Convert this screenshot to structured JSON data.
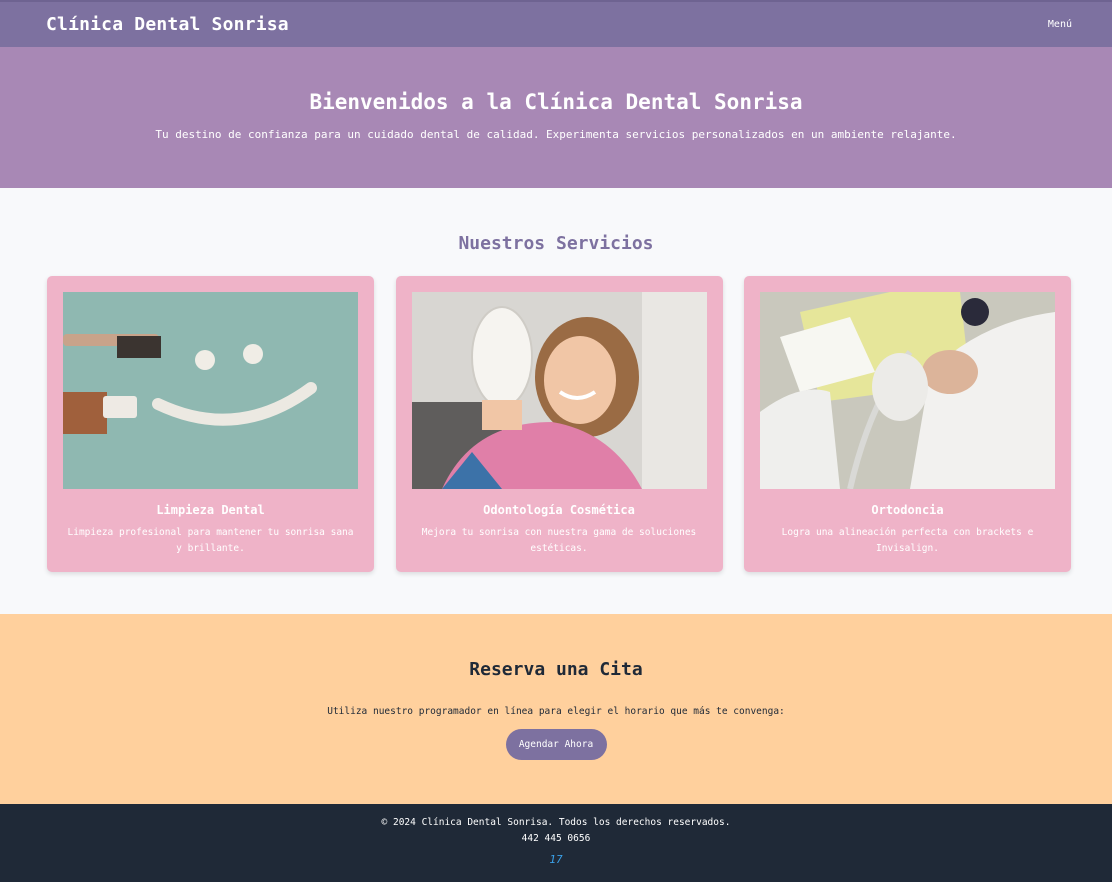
{
  "nav": {
    "brand": "Clínica Dental Sonrisa",
    "menu": "Menú"
  },
  "hero": {
    "title": "Bienvenidos a la Clínica Dental Sonrisa",
    "subtitle": "Tu destino de confianza para un cuidado dental de calidad. Experimenta servicios personalizados en un ambiente relajante."
  },
  "services": {
    "title": "Nuestros Servicios",
    "items": [
      {
        "title": "Limpieza Dental",
        "description": "Limpieza profesional para mantener tu sonrisa sana y brillante.",
        "image": "toothbrush-smile-photo"
      },
      {
        "title": "Odontología Cosmética",
        "description": "Mejora tu sonrisa con nuestra gama de soluciones estéticas.",
        "image": "woman-mirror-photo"
      },
      {
        "title": "Ortodoncia",
        "description": "Logra una alineación perfecta con brackets e Invisalign.",
        "image": "dentist-procedure-photo"
      }
    ]
  },
  "booking": {
    "title": "Reserva una Cita",
    "text": "Utiliza nuestro programador en línea para elegir el horario que más te convenga:",
    "button": "Agendar Ahora"
  },
  "footer": {
    "copyright": "© 2024 Clínica Dental Sonrisa. Todos los derechos reservados.",
    "phone": "442 445 0656",
    "logo": "17"
  },
  "colors": {
    "nav": "#7d71a0",
    "hero": "#a888b5",
    "card": "#efb3c8",
    "booking": "#ffd09d",
    "footer": "#1f2937",
    "accent": "#7d71a0"
  }
}
